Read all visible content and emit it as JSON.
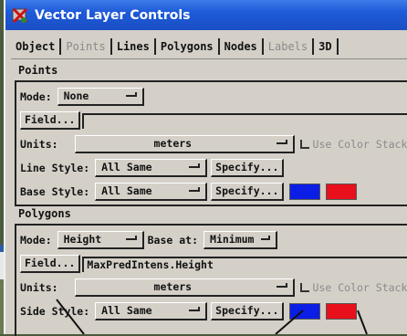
{
  "window": {
    "title": "Vector Layer Controls"
  },
  "tabs": [
    {
      "label": "Object",
      "enabled": true
    },
    {
      "label": "Points",
      "enabled": false
    },
    {
      "label": "Lines",
      "enabled": true
    },
    {
      "label": "Polygons",
      "enabled": true
    },
    {
      "label": "Nodes",
      "enabled": true
    },
    {
      "label": "Labels",
      "enabled": false
    },
    {
      "label": "3D",
      "enabled": true
    }
  ],
  "points": {
    "heading": "Points",
    "mode_label": "Mode:",
    "mode_value": "None",
    "field_button": "Field...",
    "field_value": "",
    "units_label": "Units:",
    "units_value": "meters",
    "color_stack_label": "Use Color Stack",
    "line_style_label": "Line Style:",
    "line_style_value": "All Same",
    "specify_button": "Specify...",
    "base_style_label": "Base Style:",
    "base_style_value": "All Same",
    "base_colors": [
      "#0a1ee6",
      "#e8101a"
    ]
  },
  "polygons": {
    "heading": "Polygons",
    "mode_label": "Mode:",
    "mode_value": "Height",
    "base_at_label": "Base at:",
    "base_at_value": "Minimum",
    "field_button": "Field...",
    "field_value": "MaxPredIntens.Height",
    "units_label": "Units:",
    "units_value": "meters",
    "color_stack_label": "Use Color Stack",
    "side_style_label": "Side Style:",
    "side_style_value": "All Same",
    "specify_button": "Specify...",
    "side_colors": [
      "#0a1ee6",
      "#e8101a"
    ]
  }
}
